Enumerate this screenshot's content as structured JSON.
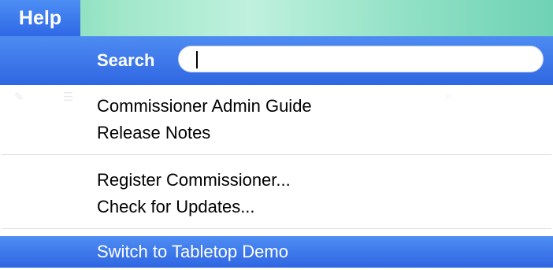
{
  "menubar": {
    "title": "Help",
    "background": "#9ee6c8",
    "highlight_color": "#3a78ec"
  },
  "search": {
    "label": "Search",
    "value": ""
  },
  "items_group1": [
    {
      "label": "Commissioner Admin Guide"
    },
    {
      "label": "Release Notes"
    }
  ],
  "items_group2": [
    {
      "label": "Register Commissioner..."
    },
    {
      "label": "Check for Updates..."
    }
  ],
  "highlighted_item": {
    "label": "Switch to Tabletop Demo",
    "state": "highlighted"
  }
}
